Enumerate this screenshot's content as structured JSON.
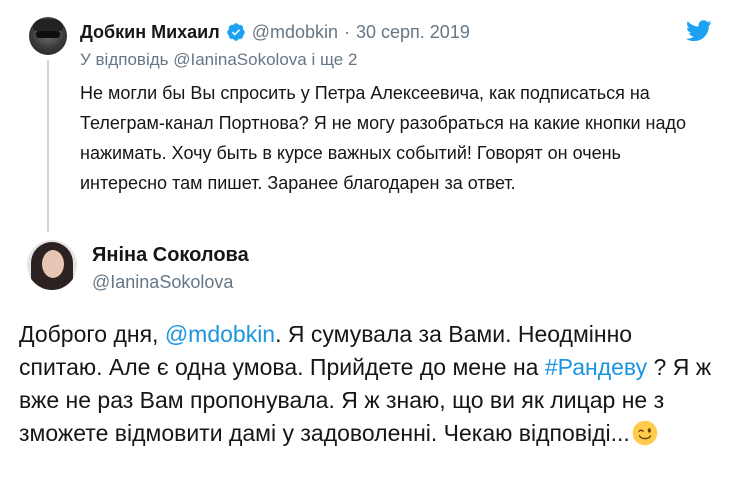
{
  "parent_tweet": {
    "author_name": "Добкин Михаил",
    "handle": "@mdobkin",
    "separator": "·",
    "date": "30 серп. 2019",
    "reply_prefix": "У відповідь",
    "reply_mention": "@IaninaSokolova",
    "reply_suffix": "і ще 2",
    "text": "Не могли бы Вы спросить у Петра Алексеевича, как подписаться на Телеграм-канал Портнова? Я не могу разобраться на какие кнопки надо нажимать. Хочу быть в курсе важных событий! Говорят он очень интересно там пишет. Заранее благодарен за ответ."
  },
  "main_tweet": {
    "author_name": "Яніна Соколова",
    "handle": "@IaninaSokolova",
    "text_1": "Доброго дня, ",
    "mention": "@mdobkin",
    "text_2": ". Я сумувала за Вами. Неодмінно спитаю. Але є одна умова. Прийдете до мене на ",
    "hashtag": "#Рандеву",
    "text_3": " ? Я ж вже не раз Вам пропонувала. Я ж знаю, що ви як лицар не з зможете відмовити дамі у задоволенні. Чекаю відповіді...",
    "emoji": "winking-face-emoji"
  },
  "colors": {
    "accent": "#1b95e0",
    "secondary_text": "#657786",
    "primary_text": "#14171a",
    "verified": "#1da1f2",
    "thread_line": "#ccd6dd"
  },
  "icons": {
    "verified": "verified-badge-icon",
    "logo": "twitter-bird-icon"
  }
}
